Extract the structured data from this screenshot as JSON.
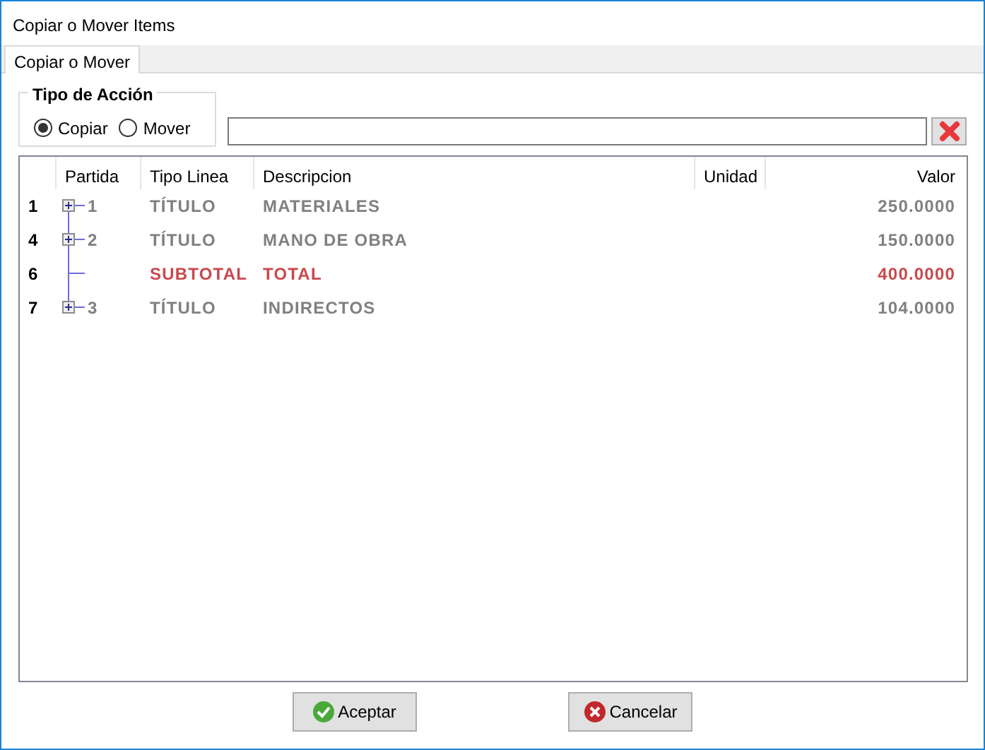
{
  "window": {
    "title": "Copiar o Mover Items"
  },
  "tabs": [
    {
      "label": "Copiar o Mover",
      "selected": true
    }
  ],
  "action_group": {
    "title": "Tipo de Acción",
    "options": [
      {
        "label": "Copiar",
        "selected": true
      },
      {
        "label": "Mover",
        "selected": false
      }
    ]
  },
  "grid": {
    "columns": [
      "Partida",
      "Tipo Linea",
      "Descripcion",
      "Unidad",
      "Valor"
    ],
    "rows": [
      {
        "row_number": "1",
        "kind": "title",
        "expanded": false,
        "partida": "1",
        "tipo": "TÍTULO",
        "descripcion": "MATERIALES",
        "valor": "250.0000"
      },
      {
        "row_number": "4",
        "kind": "title",
        "expanded": false,
        "partida": "2",
        "tipo": "TÍTULO",
        "descripcion": "MANO DE OBRA",
        "valor": "150.0000"
      },
      {
        "row_number": "6",
        "kind": "subtotal",
        "tipo": "SUBTOTAL",
        "descripcion": "TOTAL",
        "valor": "400.0000"
      },
      {
        "row_number": "7",
        "kind": "title",
        "expanded": false,
        "partida": "3",
        "tipo": "TÍTULO",
        "descripcion": "INDIRECTOS",
        "valor": "104.0000"
      }
    ]
  },
  "buttons": [
    {
      "label": "Aceptar",
      "kind": "ok"
    },
    {
      "label": "Cancelar",
      "kind": "cancel"
    }
  ]
}
